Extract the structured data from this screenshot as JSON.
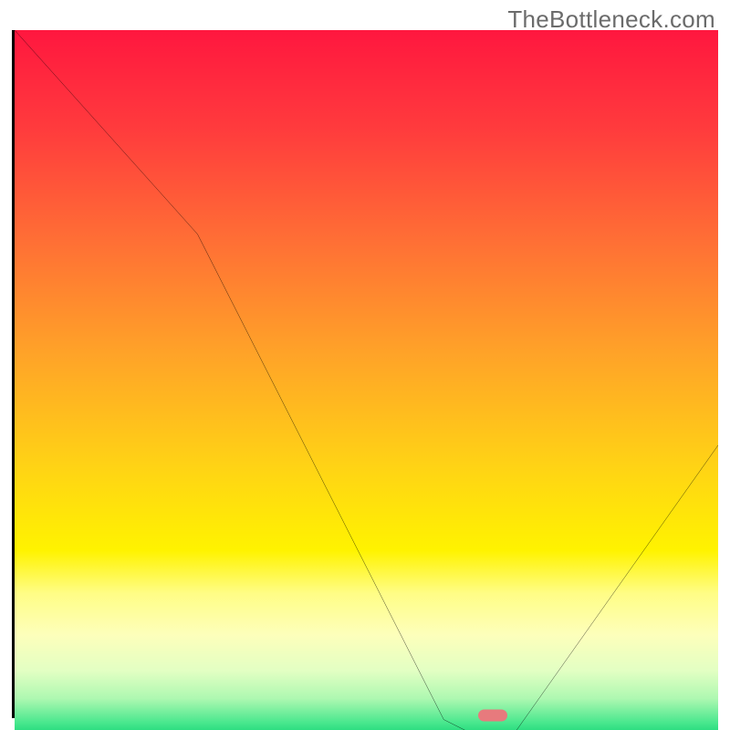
{
  "watermark": "TheBottleneck.com",
  "chart_data": {
    "type": "line",
    "title": "",
    "xlabel": "",
    "ylabel": "",
    "xlim": [
      0,
      100
    ],
    "ylim": [
      0,
      100
    ],
    "series": [
      {
        "name": "curve",
        "x": [
          0,
          26,
          61,
          65,
          71,
          100
        ],
        "values": [
          100,
          71,
          2,
          0,
          0,
          41
        ]
      }
    ],
    "marker": {
      "x": 68,
      "y": 0
    },
    "gradient_stops": [
      {
        "pos": 0.0,
        "color": "#ff173f"
      },
      {
        "pos": 0.14,
        "color": "#ff3b3d"
      },
      {
        "pos": 0.3,
        "color": "#ff6f35"
      },
      {
        "pos": 0.46,
        "color": "#ffa328"
      },
      {
        "pos": 0.62,
        "color": "#ffd315"
      },
      {
        "pos": 0.74,
        "color": "#fff300"
      },
      {
        "pos": 0.8,
        "color": "#fffd85"
      },
      {
        "pos": 0.86,
        "color": "#fdffbb"
      },
      {
        "pos": 0.91,
        "color": "#e3ffc3"
      },
      {
        "pos": 0.95,
        "color": "#aef8b1"
      },
      {
        "pos": 0.985,
        "color": "#47e78d"
      },
      {
        "pos": 1.0,
        "color": "#21d97b"
      }
    ]
  }
}
